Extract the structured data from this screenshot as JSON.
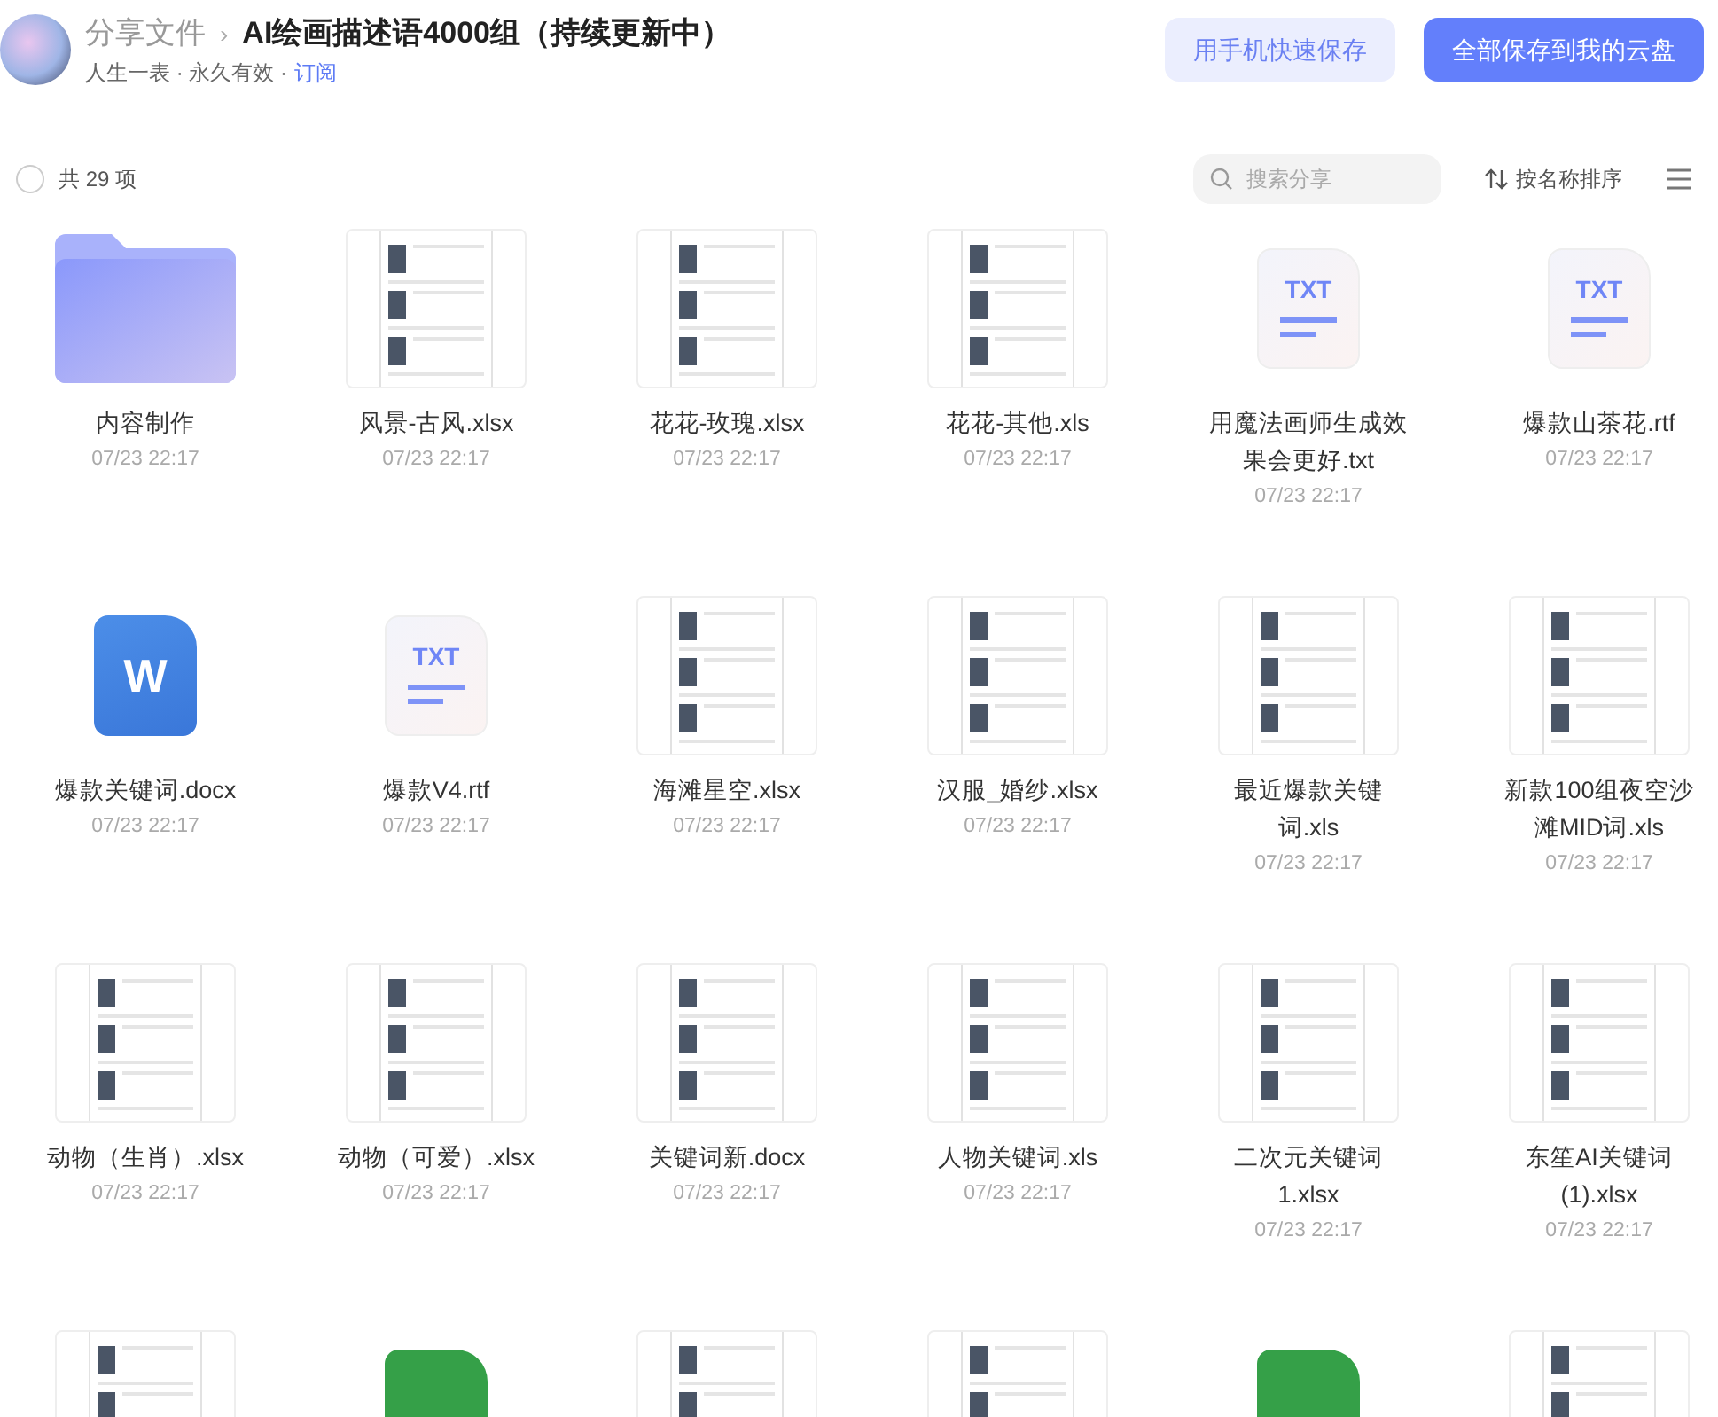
{
  "header": {
    "breadcrumb": "分享文件",
    "separator": "›",
    "title": "AI绘画描述语4000组（持续更新中）",
    "meta": "人生一表 · 永久有效 ·",
    "subscribe_link": "订阅"
  },
  "buttons": [
    {
      "label": "用手机快速保存",
      "kind": "secondary"
    },
    {
      "label": "全部保存到我的云盘",
      "kind": "primary"
    }
  ],
  "toolbar": {
    "select_all_checked": false,
    "count": "共 29 项",
    "search": {
      "placeholder": "搜索分享"
    },
    "sort": "按名称排序"
  },
  "files": [
    {
      "kind": "folder",
      "name": "内容制作",
      "date": "07/23 22:17"
    },
    {
      "kind": "thumb",
      "name": "风景-古风.xlsx",
      "date": "07/23 22:17"
    },
    {
      "kind": "thumb",
      "name": "花花-玫瑰.xlsx",
      "date": "07/23 22:17"
    },
    {
      "kind": "thumb",
      "name": "花花-其他.xls",
      "date": "07/23 22:17"
    },
    {
      "kind": "txt",
      "icon_label": "TXT",
      "name": "用魔法画师生成效果会更好.txt",
      "date": "07/23 22:17"
    },
    {
      "kind": "txt",
      "icon_label": "TXT",
      "name": "爆款山茶花.rtf",
      "date": "07/23 22:17"
    },
    {
      "kind": "word",
      "icon_label": "W",
      "name": "爆款关键词.docx",
      "date": "07/23 22:17"
    },
    {
      "kind": "txt",
      "icon_label": "TXT",
      "name": "爆款V4.rtf",
      "date": "07/23 22:17"
    },
    {
      "kind": "thumb",
      "name": "海滩星空.xlsx",
      "date": "07/23 22:17"
    },
    {
      "kind": "thumb",
      "name": "汉服_婚纱.xlsx",
      "date": "07/23 22:17"
    },
    {
      "kind": "thumb",
      "name": "最近爆款关键词.xls",
      "date": "07/23 22:17"
    },
    {
      "kind": "thumb",
      "name": "新款100组夜空沙滩MID词.xls",
      "date": "07/23 22:17"
    },
    {
      "kind": "thumb",
      "name": "动物（生肖）.xlsx",
      "date": "07/23 22:17"
    },
    {
      "kind": "thumb",
      "name": "动物（可爱）.xlsx",
      "date": "07/23 22:17"
    },
    {
      "kind": "thumb",
      "name": "关键词新.docx",
      "date": "07/23 22:17"
    },
    {
      "kind": "thumb",
      "name": "人物关键词.xls",
      "date": "07/23 22:17"
    },
    {
      "kind": "thumb",
      "name": "二次元关键词1.xlsx",
      "date": "07/23 22:17"
    },
    {
      "kind": "thumb",
      "name": "东笙AI关键词(1).xlsx",
      "date": "07/23 22:17"
    },
    {
      "kind": "thumb"
    },
    {
      "kind": "excel"
    },
    {
      "kind": "thumb"
    },
    {
      "kind": "thumb"
    },
    {
      "kind": "excel"
    },
    {
      "kind": "thumb"
    }
  ]
}
